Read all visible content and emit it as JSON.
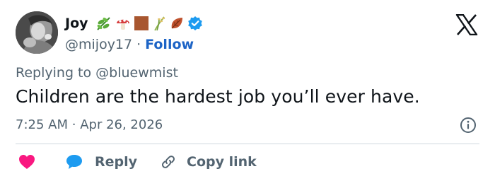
{
  "author": {
    "display_name": "Joy",
    "handle": "@mijoy17",
    "separator": "·",
    "follow_label": "Follow",
    "name_emojis": [
      "herb-icon",
      "mushroom-icon",
      "brown-square-icon",
      "rice-plant-icon",
      "fallen-leaf-icon"
    ],
    "verified_icon": "verified-badge-icon",
    "verified_color": "#1d9bf0"
  },
  "platform_logo": "x-logo-icon",
  "tweet": {
    "replying_prefix": "Replying to",
    "replying_to": "@bluewmist",
    "text": "Children are the hardest job you’ll ever have.",
    "time": "7:25 AM",
    "meta_separator": "·",
    "date": "Apr 26, 2026"
  },
  "actions": {
    "like_icon": "heart-icon",
    "like_color": "#f91880",
    "reply_icon": "speech-bubble-icon",
    "reply_color": "#1d9bf0",
    "reply_label": "Reply",
    "copy_icon": "link-icon",
    "copy_label": "Copy link"
  },
  "colors": {
    "text": "#0f1419",
    "secondary": "#536471",
    "link": "#1d64c6",
    "divider": "#cfd9de"
  }
}
